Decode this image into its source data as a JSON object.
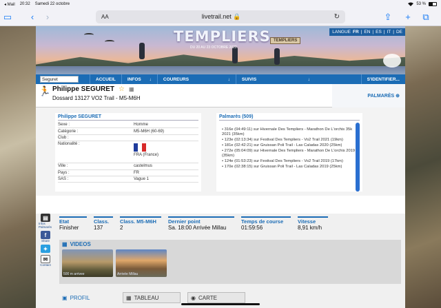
{
  "status_bar": {
    "back_app": "◂ Mail",
    "time": "20:32",
    "date": "Samedi 22 octobre",
    "battery_text": "53 %",
    "battery_level": 0.53
  },
  "browser": {
    "text_size_label": "AA",
    "url": "livetrail.net 🔒"
  },
  "banner": {
    "title": "TEMPLIERS",
    "subtitle": "DU 20 AU 23 OCTOBRE 2022",
    "sign_text": "TEMPLIERS",
    "lang_label": "LANGUE",
    "langs": [
      "FR",
      "EN",
      "ES",
      "IT",
      "DE"
    ]
  },
  "nav": {
    "search_value": "Seguret",
    "items": [
      "ACCUEIL",
      "INFOS",
      "COUREURS",
      "SUIVIS",
      "S'IDENTIFIER..."
    ]
  },
  "runner": {
    "name": "Philippe SEGURET",
    "dossard": "Dossard 13127   VO2 Trail - M5-M6H",
    "palmares_tab": "PALMARÈS ⊕"
  },
  "identity": {
    "heading": "Philippe SEGURET",
    "rows": [
      {
        "k": "Sexe :",
        "v": "Homme"
      },
      {
        "k": "Catégorie :",
        "v": "M5-M6H (60-69)"
      },
      {
        "k": "Club :",
        "v": ""
      },
      {
        "k": "Nationalité :",
        "v": "FRA (France)"
      },
      {
        "k": "Ville :",
        "v": "castelmus"
      },
      {
        "k": "Pays :",
        "v": "FR"
      },
      {
        "k": "SAS :",
        "v": "Vague 1"
      }
    ]
  },
  "palmares": {
    "heading": "Palmarès   (509)",
    "items": [
      "316e (04:49:11) sur Hivernale Des Templiers - Marathon De L'orchis 35k 2021 (35km)",
      "123e (02:13:34) sur Festival Des Templiers - Vo2 Trail 2021 (19km)",
      "181e (02:42:21) sur Gruissan Poli Trail - Las Caladas 2020 (25km)",
      "272e (05:04:09) sur Hivernale Des Templiers - Marathon De L'orchis 2019 (35km)",
      "124e (01:53:23) sur Festival Des Templiers - Vo2 Trail 2019 (17km)",
      "170e (02:38:15) sur Gruissan Poli Trail - Las Caladas 2019 (25km)"
    ]
  },
  "race": {
    "side": [
      "Infos Palmarès",
      "Share",
      "",
      "Contact"
    ],
    "cols": [
      {
        "h": "Etat",
        "v": "Finisher"
      },
      {
        "h": "Class.",
        "v": "137"
      },
      {
        "h": "Class. M5-M6H",
        "v": "2"
      },
      {
        "h": "Dernier point",
        "v": "Sa. 18:00   Arrivée Millau"
      },
      {
        "h": "Temps de course",
        "v": "01:59:56"
      },
      {
        "h": "Vitesse",
        "v": "8,91 km/h"
      }
    ],
    "videos_label": "VIDEOS",
    "thumbs": [
      "500 m arrivee",
      "Arrivée Millau"
    ],
    "tabs": [
      "PROFIL",
      "TABLEAU",
      "CARTE"
    ]
  }
}
